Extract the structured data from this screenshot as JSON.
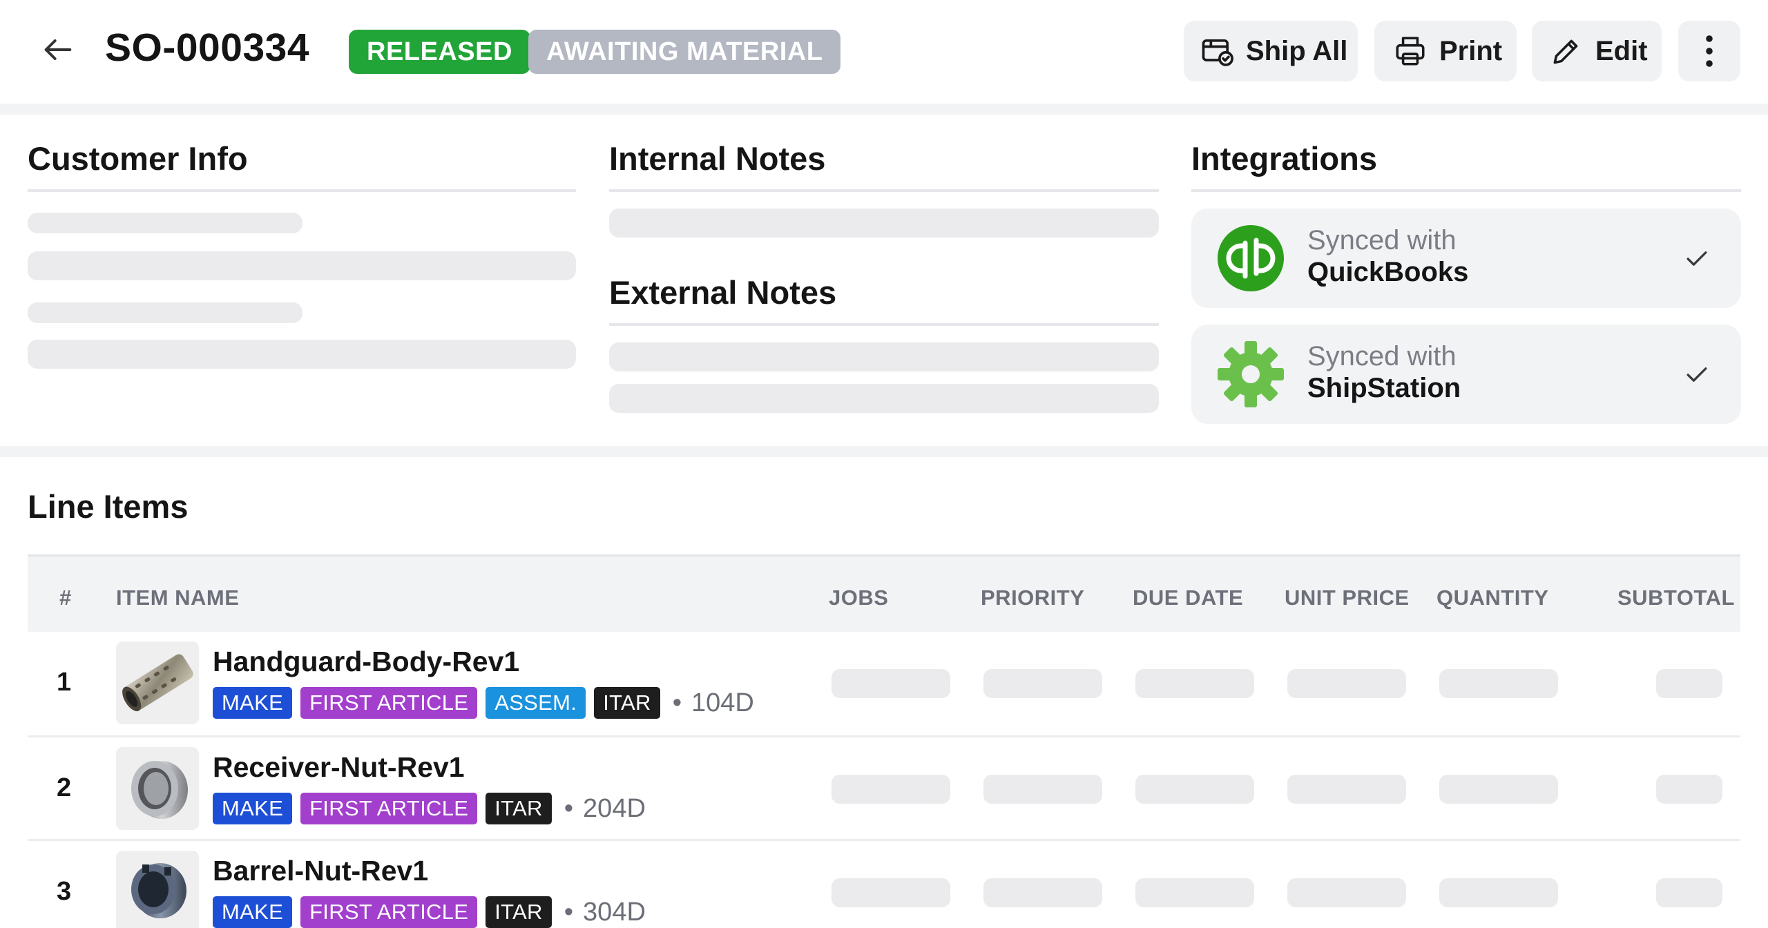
{
  "header": {
    "title": "SO-000334",
    "status_badges": [
      "RELEASED",
      "AWAITING MATERIAL"
    ],
    "actions": {
      "ship_all": "Ship All",
      "print": "Print",
      "edit": "Edit"
    }
  },
  "sections": {
    "customer_info": "Customer Info",
    "internal_notes": "Internal Notes",
    "external_notes": "External Notes",
    "integrations": "Integrations"
  },
  "integrations": [
    {
      "prefix": "Synced with",
      "name": "QuickBooks",
      "icon": "quickbooks-logo",
      "color": "#2ca01c"
    },
    {
      "prefix": "Synced with",
      "name": "ShipStation",
      "icon": "shipstation-gear-logo",
      "color": "#6bc04b"
    }
  ],
  "line_items": {
    "title": "Line Items",
    "columns": [
      "#",
      "ITEM NAME",
      "JOBS",
      "PRIORITY",
      "DUE DATE",
      "UNIT PRICE",
      "QUANTITY",
      "SUBTOTAL"
    ],
    "rows": [
      {
        "num": "1",
        "name": "Handguard-Body-Rev1",
        "tags": [
          "MAKE",
          "FIRST ARTICLE",
          "ASSEM.",
          "ITAR"
        ],
        "lead_time": "104D"
      },
      {
        "num": "2",
        "name": "Receiver-Nut-Rev1",
        "tags": [
          "MAKE",
          "FIRST ARTICLE",
          "ITAR"
        ],
        "lead_time": "204D"
      },
      {
        "num": "3",
        "name": "Barrel-Nut-Rev1",
        "tags": [
          "MAKE",
          "FIRST ARTICLE",
          "ITAR"
        ],
        "lead_time": "304D"
      }
    ]
  },
  "colors": {
    "released": "#22a538",
    "awaiting": "#b3b8c3",
    "tag_make": "#1d4fd6",
    "tag_first_article": "#a23fcc",
    "tag_assem": "#1a92de",
    "tag_itar": "#1e1e1e"
  }
}
